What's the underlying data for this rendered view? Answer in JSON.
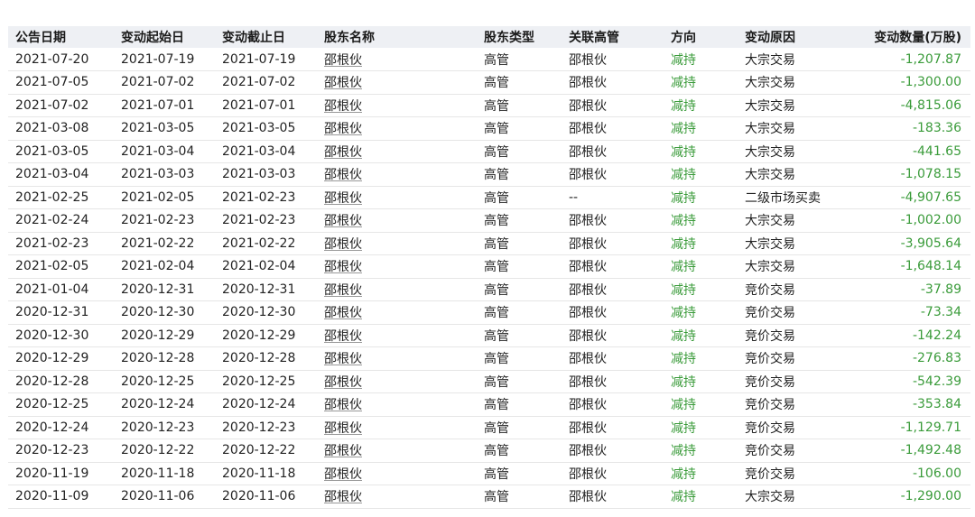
{
  "legend": {
    "items": [
      {
        "color": "#c9a227"
      },
      {
        "color": "#7ab648"
      },
      {
        "color": "#7ab648"
      }
    ]
  },
  "colors": {
    "decrease": "#3a9b3a",
    "header_bg": "#eef0f4"
  },
  "table": {
    "columns": [
      "公告日期",
      "变动起始日",
      "变动截止日",
      "股东名称",
      "股东类型",
      "关联高管",
      "方向",
      "变动原因",
      "变动数量(万股)"
    ],
    "rows": [
      [
        "2021-07-20",
        "2021-07-19",
        "2021-07-19",
        "邵根伙",
        "高管",
        "邵根伙",
        "减持",
        "大宗交易",
        "-1,207.87"
      ],
      [
        "2021-07-05",
        "2021-07-02",
        "2021-07-02",
        "邵根伙",
        "高管",
        "邵根伙",
        "减持",
        "大宗交易",
        "-1,300.00"
      ],
      [
        "2021-07-02",
        "2021-07-01",
        "2021-07-01",
        "邵根伙",
        "高管",
        "邵根伙",
        "减持",
        "大宗交易",
        "-4,815.06"
      ],
      [
        "2021-03-08",
        "2021-03-05",
        "2021-03-05",
        "邵根伙",
        "高管",
        "邵根伙",
        "减持",
        "大宗交易",
        "-183.36"
      ],
      [
        "2021-03-05",
        "2021-03-04",
        "2021-03-04",
        "邵根伙",
        "高管",
        "邵根伙",
        "减持",
        "大宗交易",
        "-441.65"
      ],
      [
        "2021-03-04",
        "2021-03-03",
        "2021-03-03",
        "邵根伙",
        "高管",
        "邵根伙",
        "减持",
        "大宗交易",
        "-1,078.15"
      ],
      [
        "2021-02-25",
        "2021-02-05",
        "2021-02-23",
        "邵根伙",
        "高管",
        "--",
        "减持",
        "二级市场买卖",
        "-4,907.65"
      ],
      [
        "2021-02-24",
        "2021-02-23",
        "2021-02-23",
        "邵根伙",
        "高管",
        "邵根伙",
        "减持",
        "大宗交易",
        "-1,002.00"
      ],
      [
        "2021-02-23",
        "2021-02-22",
        "2021-02-22",
        "邵根伙",
        "高管",
        "邵根伙",
        "减持",
        "大宗交易",
        "-3,905.64"
      ],
      [
        "2021-02-05",
        "2021-02-04",
        "2021-02-04",
        "邵根伙",
        "高管",
        "邵根伙",
        "减持",
        "大宗交易",
        "-1,648.14"
      ],
      [
        "2021-01-04",
        "2020-12-31",
        "2020-12-31",
        "邵根伙",
        "高管",
        "邵根伙",
        "减持",
        "竞价交易",
        "-37.89"
      ],
      [
        "2020-12-31",
        "2020-12-30",
        "2020-12-30",
        "邵根伙",
        "高管",
        "邵根伙",
        "减持",
        "竞价交易",
        "-73.34"
      ],
      [
        "2020-12-30",
        "2020-12-29",
        "2020-12-29",
        "邵根伙",
        "高管",
        "邵根伙",
        "减持",
        "竞价交易",
        "-142.24"
      ],
      [
        "2020-12-29",
        "2020-12-28",
        "2020-12-28",
        "邵根伙",
        "高管",
        "邵根伙",
        "减持",
        "竞价交易",
        "-276.83"
      ],
      [
        "2020-12-28",
        "2020-12-25",
        "2020-12-25",
        "邵根伙",
        "高管",
        "邵根伙",
        "减持",
        "竞价交易",
        "-542.39"
      ],
      [
        "2020-12-25",
        "2020-12-24",
        "2020-12-24",
        "邵根伙",
        "高管",
        "邵根伙",
        "减持",
        "竞价交易",
        "-353.84"
      ],
      [
        "2020-12-24",
        "2020-12-23",
        "2020-12-23",
        "邵根伙",
        "高管",
        "邵根伙",
        "减持",
        "竞价交易",
        "-1,129.71"
      ],
      [
        "2020-12-23",
        "2020-12-22",
        "2020-12-22",
        "邵根伙",
        "高管",
        "邵根伙",
        "减持",
        "竞价交易",
        "-1,492.48"
      ],
      [
        "2020-11-19",
        "2020-11-18",
        "2020-11-18",
        "邵根伙",
        "高管",
        "邵根伙",
        "减持",
        "竞价交易",
        "-106.00"
      ],
      [
        "2020-11-09",
        "2020-11-06",
        "2020-11-06",
        "邵根伙",
        "高管",
        "邵根伙",
        "减持",
        "大宗交易",
        "-1,290.00"
      ]
    ]
  }
}
